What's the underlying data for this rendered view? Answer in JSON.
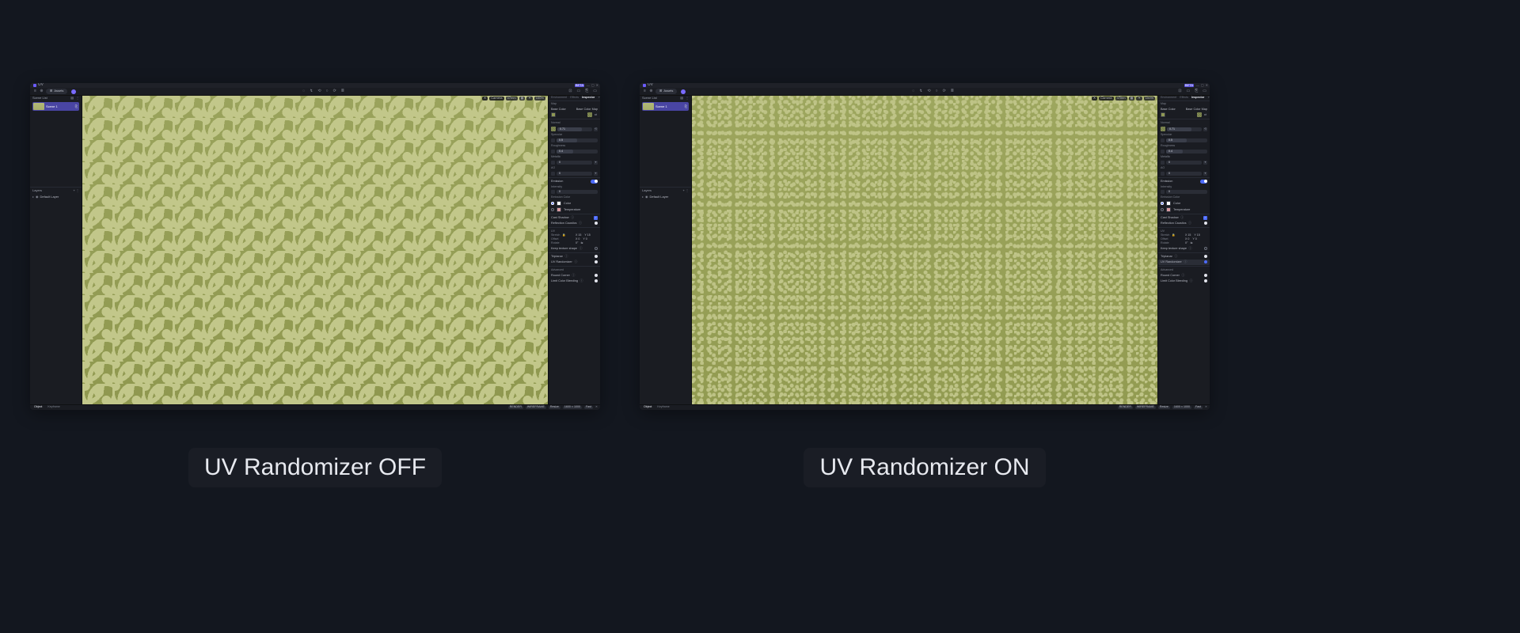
{
  "captions": {
    "off": "UV Randomizer OFF",
    "on": "UV Randomizer ON"
  },
  "titlebar": {
    "app_name": "UV",
    "beta_badge": "BETA",
    "minimize": "—",
    "maximize": "▢",
    "close": "✕"
  },
  "toolbar": {
    "menu_icon": "≡",
    "new_icon": "⊕",
    "assets_label": "Assets",
    "assets_icon": "⊞",
    "center_icons": [
      "◌",
      "↯",
      "⟲",
      "○",
      "⟳",
      "≣"
    ],
    "right_icons": [
      "⊡",
      "▭",
      "⎘",
      "▭"
    ]
  },
  "left_panel": {
    "scene_list_label": "Scene List",
    "list_icons": [
      "▤",
      "⋮"
    ],
    "scene_name": "Scene 1",
    "scene_dup_icon": "⎘",
    "layers_label": "Layers",
    "layers_icons": [
      "+",
      "⋮"
    ],
    "layer_chevron": "▸",
    "layer_eye": "◉",
    "layer_name": "Default Layer"
  },
  "viewport": {
    "close_icon": "✕",
    "camera_label": "Camera",
    "fov_label": "37mm",
    "grid_icon": "▦",
    "snap_icon": "✦",
    "percent": "100%"
  },
  "inspector": {
    "tabs": {
      "environment": "Environment",
      "effects": "Effects",
      "inspector": "Inspector",
      "wand_icon": "✧"
    },
    "map_label": "Map",
    "base_color_label": "Base Color",
    "base_color_map_label": "Base Color Map",
    "link_icon": "⇄",
    "normal": {
      "label": "Normal",
      "value": "0.71",
      "pct": 71
    },
    "specular": {
      "label": "Specular",
      "value": "0.5",
      "pct": 50
    },
    "roughness": {
      "label": "Roughness",
      "value": "0.4",
      "pct": 40
    },
    "metallic": {
      "label": "Metallic",
      "value": "0",
      "pct": 0
    },
    "ao": {
      "label": "AO",
      "value": "0",
      "pct": 0
    },
    "emission": {
      "label": "Emission",
      "on": true
    },
    "intensity": {
      "label": "Intensity",
      "value": "0",
      "pct": 0
    },
    "emission_color": {
      "label": "Emission Color",
      "option_color": "Color",
      "option_temp": "Temperature"
    },
    "cast_shadow": {
      "label": "Cast Shadow",
      "info": "ⓘ",
      "on": true
    },
    "reflection_caustics": {
      "label": "Reflection Caustics",
      "info": "ⓘ"
    },
    "uv_section": "UV",
    "uv": {
      "stretch_label": "Stretch",
      "stretch_x": "X 15",
      "stretch_y": "Y 15",
      "lock": "🔒",
      "offset_label": "Offset",
      "offset_x": "X 0",
      "offset_y": "Y 0",
      "rotate_label": "Rotate",
      "rotate_val": "0°",
      "flip_icon": "⇋"
    },
    "keep_texture_shape": {
      "label": "Keep texture shape",
      "info": "ⓘ"
    },
    "triplanar": {
      "label": "Triplanar",
      "info": "ⓘ"
    },
    "uv_randomizer": {
      "label": "UV Randomizer",
      "info": "ⓘ",
      "off_state": false,
      "on_state": true
    },
    "advanced_label": "Advanced",
    "round_corner": {
      "label": "Round Corner",
      "info": "ⓘ"
    },
    "limit_color_bleeding": {
      "label": "Limit Color Bleeding",
      "info": "ⓘ"
    }
  },
  "statusbar": {
    "tab_object": "Object",
    "tab_keyframe": "Keyframe",
    "render_label": "RENDER",
    "wireframe_label": "WIREFRAME",
    "resize_label": "Resize",
    "ratio_label": "1600 × 1000",
    "last_label": "Fast",
    "close_panel": "✕"
  }
}
